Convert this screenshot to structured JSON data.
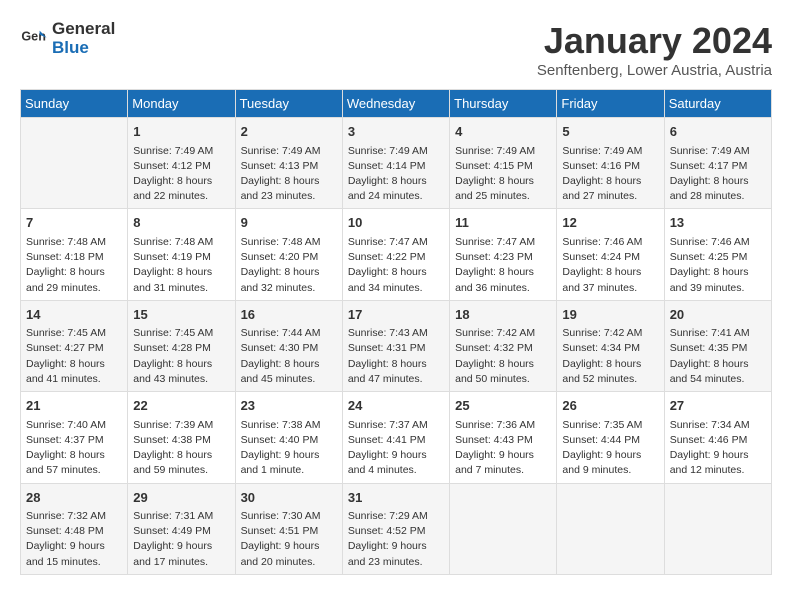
{
  "header": {
    "logo_general": "General",
    "logo_blue": "Blue",
    "month": "January 2024",
    "location": "Senftenberg, Lower Austria, Austria"
  },
  "weekdays": [
    "Sunday",
    "Monday",
    "Tuesday",
    "Wednesday",
    "Thursday",
    "Friday",
    "Saturday"
  ],
  "weeks": [
    [
      {
        "day": "",
        "sunrise": "",
        "sunset": "",
        "daylight": ""
      },
      {
        "day": "1",
        "sunrise": "Sunrise: 7:49 AM",
        "sunset": "Sunset: 4:12 PM",
        "daylight": "Daylight: 8 hours and 22 minutes."
      },
      {
        "day": "2",
        "sunrise": "Sunrise: 7:49 AM",
        "sunset": "Sunset: 4:13 PM",
        "daylight": "Daylight: 8 hours and 23 minutes."
      },
      {
        "day": "3",
        "sunrise": "Sunrise: 7:49 AM",
        "sunset": "Sunset: 4:14 PM",
        "daylight": "Daylight: 8 hours and 24 minutes."
      },
      {
        "day": "4",
        "sunrise": "Sunrise: 7:49 AM",
        "sunset": "Sunset: 4:15 PM",
        "daylight": "Daylight: 8 hours and 25 minutes."
      },
      {
        "day": "5",
        "sunrise": "Sunrise: 7:49 AM",
        "sunset": "Sunset: 4:16 PM",
        "daylight": "Daylight: 8 hours and 27 minutes."
      },
      {
        "day": "6",
        "sunrise": "Sunrise: 7:49 AM",
        "sunset": "Sunset: 4:17 PM",
        "daylight": "Daylight: 8 hours and 28 minutes."
      }
    ],
    [
      {
        "day": "7",
        "sunrise": "Sunrise: 7:48 AM",
        "sunset": "Sunset: 4:18 PM",
        "daylight": "Daylight: 8 hours and 29 minutes."
      },
      {
        "day": "8",
        "sunrise": "Sunrise: 7:48 AM",
        "sunset": "Sunset: 4:19 PM",
        "daylight": "Daylight: 8 hours and 31 minutes."
      },
      {
        "day": "9",
        "sunrise": "Sunrise: 7:48 AM",
        "sunset": "Sunset: 4:20 PM",
        "daylight": "Daylight: 8 hours and 32 minutes."
      },
      {
        "day": "10",
        "sunrise": "Sunrise: 7:47 AM",
        "sunset": "Sunset: 4:22 PM",
        "daylight": "Daylight: 8 hours and 34 minutes."
      },
      {
        "day": "11",
        "sunrise": "Sunrise: 7:47 AM",
        "sunset": "Sunset: 4:23 PM",
        "daylight": "Daylight: 8 hours and 36 minutes."
      },
      {
        "day": "12",
        "sunrise": "Sunrise: 7:46 AM",
        "sunset": "Sunset: 4:24 PM",
        "daylight": "Daylight: 8 hours and 37 minutes."
      },
      {
        "day": "13",
        "sunrise": "Sunrise: 7:46 AM",
        "sunset": "Sunset: 4:25 PM",
        "daylight": "Daylight: 8 hours and 39 minutes."
      }
    ],
    [
      {
        "day": "14",
        "sunrise": "Sunrise: 7:45 AM",
        "sunset": "Sunset: 4:27 PM",
        "daylight": "Daylight: 8 hours and 41 minutes."
      },
      {
        "day": "15",
        "sunrise": "Sunrise: 7:45 AM",
        "sunset": "Sunset: 4:28 PM",
        "daylight": "Daylight: 8 hours and 43 minutes."
      },
      {
        "day": "16",
        "sunrise": "Sunrise: 7:44 AM",
        "sunset": "Sunset: 4:30 PM",
        "daylight": "Daylight: 8 hours and 45 minutes."
      },
      {
        "day": "17",
        "sunrise": "Sunrise: 7:43 AM",
        "sunset": "Sunset: 4:31 PM",
        "daylight": "Daylight: 8 hours and 47 minutes."
      },
      {
        "day": "18",
        "sunrise": "Sunrise: 7:42 AM",
        "sunset": "Sunset: 4:32 PM",
        "daylight": "Daylight: 8 hours and 50 minutes."
      },
      {
        "day": "19",
        "sunrise": "Sunrise: 7:42 AM",
        "sunset": "Sunset: 4:34 PM",
        "daylight": "Daylight: 8 hours and 52 minutes."
      },
      {
        "day": "20",
        "sunrise": "Sunrise: 7:41 AM",
        "sunset": "Sunset: 4:35 PM",
        "daylight": "Daylight: 8 hours and 54 minutes."
      }
    ],
    [
      {
        "day": "21",
        "sunrise": "Sunrise: 7:40 AM",
        "sunset": "Sunset: 4:37 PM",
        "daylight": "Daylight: 8 hours and 57 minutes."
      },
      {
        "day": "22",
        "sunrise": "Sunrise: 7:39 AM",
        "sunset": "Sunset: 4:38 PM",
        "daylight": "Daylight: 8 hours and 59 minutes."
      },
      {
        "day": "23",
        "sunrise": "Sunrise: 7:38 AM",
        "sunset": "Sunset: 4:40 PM",
        "daylight": "Daylight: 9 hours and 1 minute."
      },
      {
        "day": "24",
        "sunrise": "Sunrise: 7:37 AM",
        "sunset": "Sunset: 4:41 PM",
        "daylight": "Daylight: 9 hours and 4 minutes."
      },
      {
        "day": "25",
        "sunrise": "Sunrise: 7:36 AM",
        "sunset": "Sunset: 4:43 PM",
        "daylight": "Daylight: 9 hours and 7 minutes."
      },
      {
        "day": "26",
        "sunrise": "Sunrise: 7:35 AM",
        "sunset": "Sunset: 4:44 PM",
        "daylight": "Daylight: 9 hours and 9 minutes."
      },
      {
        "day": "27",
        "sunrise": "Sunrise: 7:34 AM",
        "sunset": "Sunset: 4:46 PM",
        "daylight": "Daylight: 9 hours and 12 minutes."
      }
    ],
    [
      {
        "day": "28",
        "sunrise": "Sunrise: 7:32 AM",
        "sunset": "Sunset: 4:48 PM",
        "daylight": "Daylight: 9 hours and 15 minutes."
      },
      {
        "day": "29",
        "sunrise": "Sunrise: 7:31 AM",
        "sunset": "Sunset: 4:49 PM",
        "daylight": "Daylight: 9 hours and 17 minutes."
      },
      {
        "day": "30",
        "sunrise": "Sunrise: 7:30 AM",
        "sunset": "Sunset: 4:51 PM",
        "daylight": "Daylight: 9 hours and 20 minutes."
      },
      {
        "day": "31",
        "sunrise": "Sunrise: 7:29 AM",
        "sunset": "Sunset: 4:52 PM",
        "daylight": "Daylight: 9 hours and 23 minutes."
      },
      {
        "day": "",
        "sunrise": "",
        "sunset": "",
        "daylight": ""
      },
      {
        "day": "",
        "sunrise": "",
        "sunset": "",
        "daylight": ""
      },
      {
        "day": "",
        "sunrise": "",
        "sunset": "",
        "daylight": ""
      }
    ]
  ]
}
